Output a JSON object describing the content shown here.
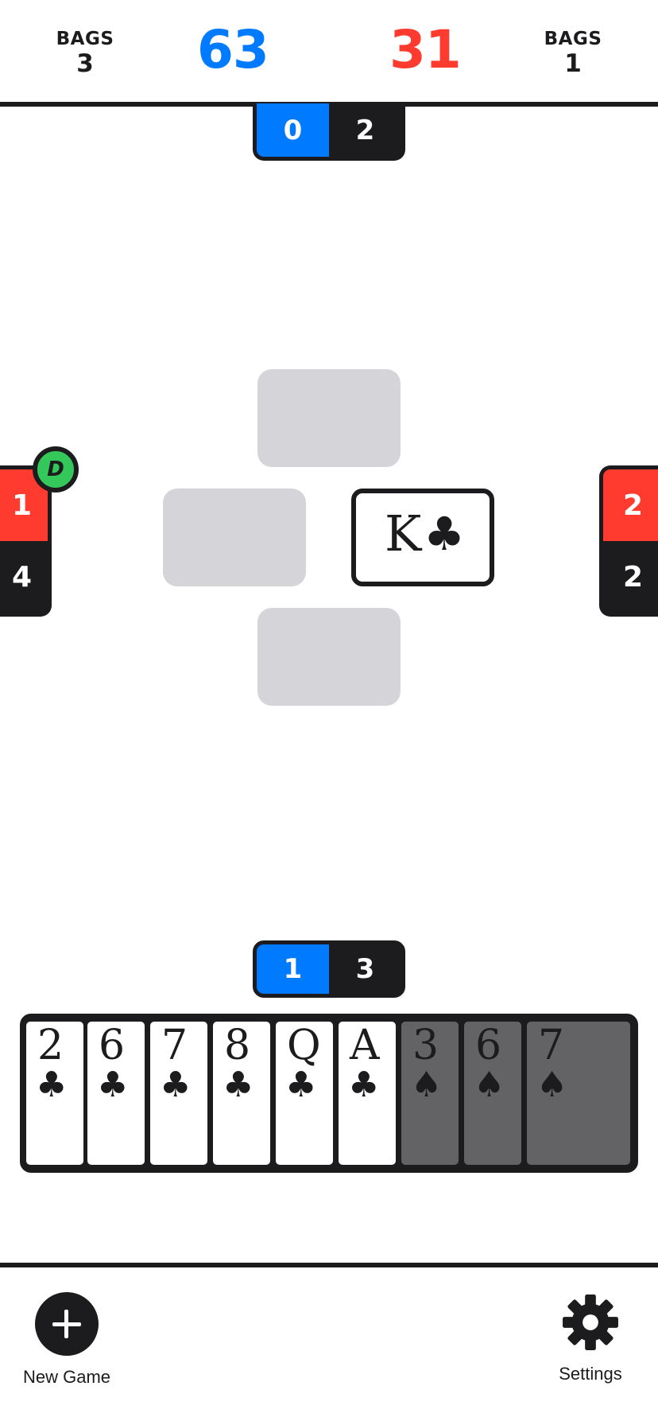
{
  "header": {
    "left_bags": {
      "label": "BAGS",
      "value": "3"
    },
    "right_bags": {
      "label": "BAGS",
      "value": "1"
    },
    "blue_score": "63",
    "red_score": "31"
  },
  "players": {
    "top": {
      "bid": "0",
      "tricks": "2"
    },
    "left": {
      "bid": "1",
      "tricks": "4",
      "dealer_badge": "D"
    },
    "right": {
      "bid": "2",
      "tricks": "2"
    },
    "bottom": {
      "bid": "1",
      "tricks": "3"
    }
  },
  "trick": {
    "played_card": {
      "rank": "K",
      "suit": "♣"
    }
  },
  "hand": [
    {
      "rank": "2",
      "suit": "♣",
      "playable": true
    },
    {
      "rank": "6",
      "suit": "♣",
      "playable": true
    },
    {
      "rank": "7",
      "suit": "♣",
      "playable": true
    },
    {
      "rank": "8",
      "suit": "♣",
      "playable": true
    },
    {
      "rank": "Q",
      "suit": "♣",
      "playable": true
    },
    {
      "rank": "A",
      "suit": "♣",
      "playable": true
    },
    {
      "rank": "3",
      "suit": "♠",
      "playable": false
    },
    {
      "rank": "6",
      "suit": "♠",
      "playable": false
    },
    {
      "rank": "7",
      "suit": "♠",
      "playable": false
    }
  ],
  "toolbar": {
    "new_game_label": "New Game",
    "settings_label": "Settings",
    "new_game_icon": "plus-circle-icon",
    "settings_icon": "gear-icon"
  },
  "colors": {
    "blue": "#007aff",
    "red": "#ff3b30",
    "green": "#34c759",
    "dark": "#1c1c1e",
    "slot_gray": "#d4d4d9",
    "dim_card": "#636366"
  }
}
